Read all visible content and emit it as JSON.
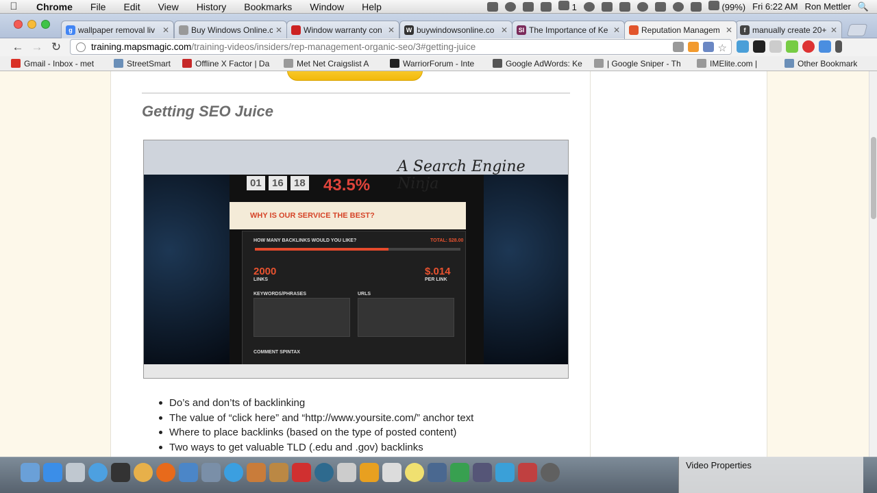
{
  "menubar": {
    "app": "Chrome",
    "items": [
      "File",
      "Edit",
      "View",
      "History",
      "Bookmarks",
      "Window",
      "Help"
    ],
    "battery": "(99%)",
    "clock": "Fri 6:22 AM",
    "user": "Ron Mettler",
    "extra_badge": "1"
  },
  "tabs": [
    {
      "title": "wallpaper removal liv",
      "color": "#4285f4",
      "glyph": "g"
    },
    {
      "title": "Buy Windows Online.c",
      "color": "#999999",
      "glyph": ""
    },
    {
      "title": "Window warranty con",
      "color": "#cc2222",
      "glyph": ""
    },
    {
      "title": "buywindowsonline.co",
      "color": "#333333",
      "glyph": "W"
    },
    {
      "title": "The Importance of Ke",
      "color": "#7a2a5a",
      "glyph": "SI"
    },
    {
      "title": "Reputation Managem",
      "color": "#e2552b",
      "glyph": "",
      "active": true
    },
    {
      "title": "manually create 20+",
      "color": "#444444",
      "glyph": "f"
    }
  ],
  "omnibox": {
    "host": "training.mapsmagic.com",
    "path": "/training-videos/insiders/rep-management-organic-seo/3#getting-juice"
  },
  "bookmarks": [
    {
      "label": "Gmail - Inbox - met",
      "color": "#d93025"
    },
    {
      "label": "StreetSmart",
      "color": "#6b8fb8"
    },
    {
      "label": "Offline X Factor | Da",
      "color": "#c62828"
    },
    {
      "label": "Met Net Craigslist A",
      "color": "#999999"
    },
    {
      "label": "WarriorForum - Inte",
      "color": "#222222"
    },
    {
      "label": "Google AdWords: Ke",
      "color": "#555555"
    },
    {
      "label": "| Google Sniper - Th",
      "color": "#999999"
    },
    {
      "label": "IMElite.com |",
      "color": "#999999"
    },
    {
      "label": "Other Bookmarks",
      "color": "#6b8fb8"
    }
  ],
  "page": {
    "heading": "Getting SEO Juice",
    "bullets": [
      "Do’s and don’ts of backlinking",
      "The value of “click here” and “http://www.yoursite.com/” anchor text",
      "Where to place backlinks (based on the type of posted content)",
      "Two ways to get valuable TLD (.edu and .gov) backlinks"
    ],
    "video": {
      "brand": "A Search Engine Ninja",
      "stats": [
        "01",
        "16",
        "18"
      ],
      "percent": "43.5%",
      "why_title": "WHY IS OUR SERVICE THE BEST?",
      "how_many": "HOW MANY BACKLINKS WOULD YOU LIKE?",
      "total": "TOTAL: $28.00",
      "links_count": "2000",
      "links_label": "LINKS",
      "price": "$.014",
      "price_label": "PER LINK",
      "keywords_label": "KEYWORDS/PHRASES",
      "urls_label": "URLS",
      "comment_label": "COMMENT SPINTAX"
    }
  },
  "dock": {
    "video_properties": "Video Properties"
  }
}
